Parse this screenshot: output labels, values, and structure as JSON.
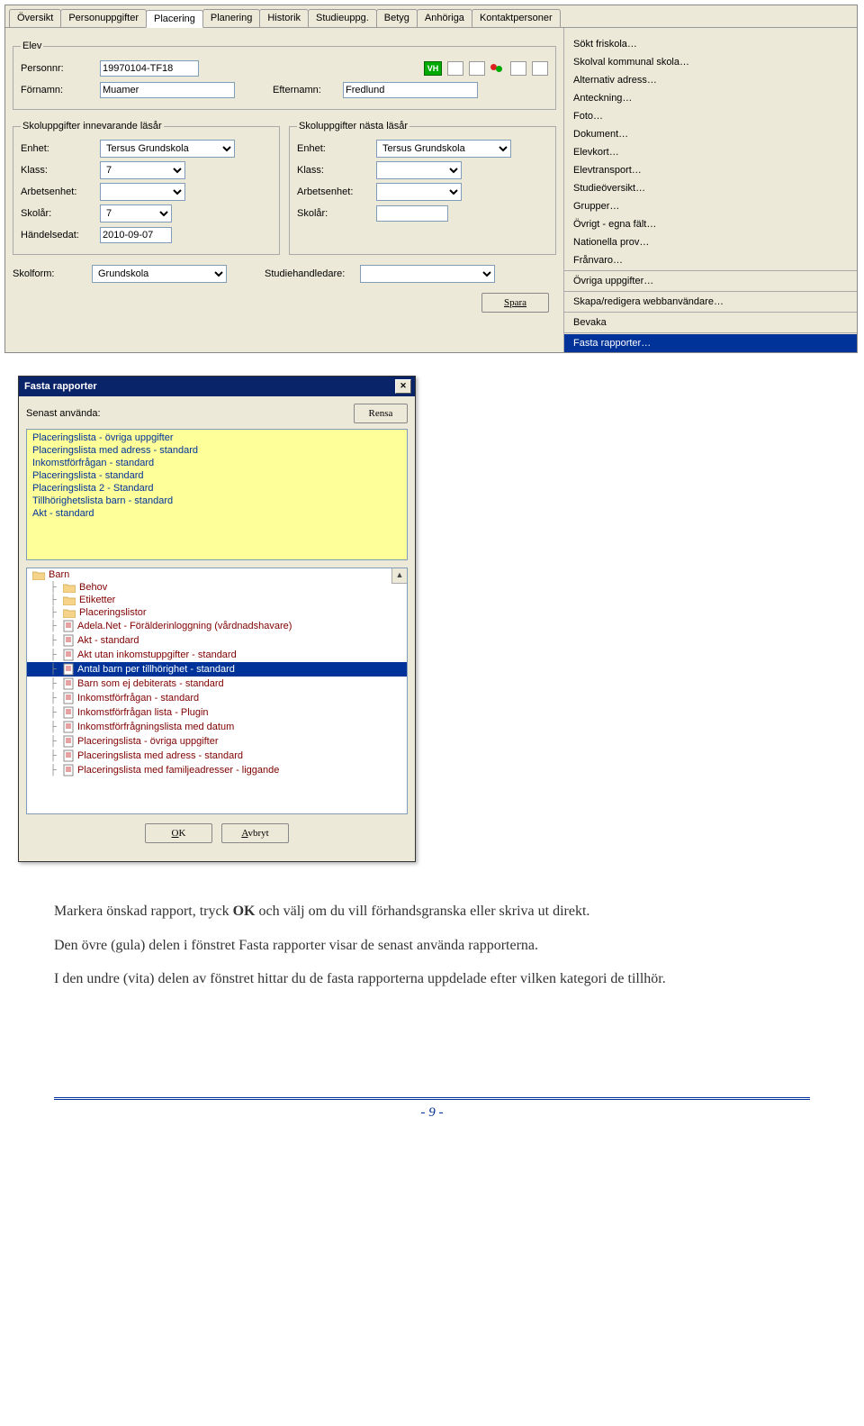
{
  "tabs": [
    "Översikt",
    "Personuppgifter",
    "Placering",
    "Planering",
    "Historik",
    "Studieuppg.",
    "Betyg",
    "Anhöriga",
    "Kontaktpersoner"
  ],
  "active_tab": 2,
  "elev": {
    "legend": "Elev",
    "personnr_label": "Personnr:",
    "personnr": "19970104-TF18",
    "fornamn_label": "Förnamn:",
    "fornamn": "Muamer",
    "efternamn_label": "Efternamn:",
    "efternamn": "Fredlund",
    "badge": "VH"
  },
  "box_current": {
    "legend": "Skoluppgifter innevarande läsår",
    "enhet_label": "Enhet:",
    "enhet": "Tersus Grundskola",
    "klass_label": "Klass:",
    "klass": "7",
    "ae_label": "Arbetsenhet:",
    "ae": "",
    "skolar_label": "Skolår:",
    "skolar": "7",
    "hdat_label": "Händelsedat:",
    "hdat": "2010-09-07"
  },
  "box_next": {
    "legend": "Skoluppgifter nästa läsår",
    "enhet_label": "Enhet:",
    "enhet": "Tersus Grundskola",
    "klass_label": "Klass:",
    "klass": "",
    "ae_label": "Arbetsenhet:",
    "ae": "",
    "skolar_label": "Skolår:",
    "skolar": ""
  },
  "bottom": {
    "skolform_label": "Skolform:",
    "skolform": "Grundskola",
    "studiehandl_label": "Studiehandledare:",
    "studiehandl": ""
  },
  "save_btn": "Spara",
  "menu": [
    "Sökt friskola…",
    "Skolval kommunal skola…",
    "Alternativ adress…",
    "Anteckning…",
    "Foto…",
    "Dokument…",
    "Elevkort…",
    "Elevtransport…",
    "Studieöversikt…",
    "Grupper…",
    "Övrigt - egna fält…",
    "Nationella prov…",
    "Frånvaro…",
    "---",
    "Övriga uppgifter…",
    "---",
    "Skapa/redigera webbanvändare…",
    "---",
    "Bevaka",
    "---",
    "Fasta rapporter…"
  ],
  "menu_selected": "Fasta rapporter…",
  "dialog": {
    "title": "Fasta rapporter",
    "senast_label": "Senast använda:",
    "rensa_btn": "Rensa",
    "recent": [
      "Placeringslista - övriga uppgifter",
      "Placeringslista med adress - standard",
      "Inkomstförfrågan - standard",
      "Placeringslista - standard",
      "Placeringslista 2 - Standard",
      "Tillhörighetslista barn - standard",
      "Akt - standard"
    ],
    "tree": [
      {
        "t": "folder",
        "lvl": 0,
        "label": "Barn"
      },
      {
        "t": "folder",
        "lvl": 1,
        "label": "Behov"
      },
      {
        "t": "folder",
        "lvl": 1,
        "label": "Etiketter"
      },
      {
        "t": "folder",
        "lvl": 1,
        "label": "Placeringslistor"
      },
      {
        "t": "doc",
        "lvl": 1,
        "label": "Adela.Net - Förälderinloggning (vårdnadshavare)"
      },
      {
        "t": "doc",
        "lvl": 1,
        "label": "Akt - standard"
      },
      {
        "t": "doc",
        "lvl": 1,
        "label": "Akt utan inkomstuppgifter - standard"
      },
      {
        "t": "doc",
        "lvl": 1,
        "label": "Antal barn per tillhörighet - standard",
        "sel": true
      },
      {
        "t": "doc",
        "lvl": 1,
        "label": "Barn som ej debiterats - standard"
      },
      {
        "t": "doc",
        "lvl": 1,
        "label": "Inkomstförfrågan - standard"
      },
      {
        "t": "doc",
        "lvl": 1,
        "label": "Inkomstförfrågan lista - Plugin"
      },
      {
        "t": "doc",
        "lvl": 1,
        "label": "Inkomstförfrågningslista med datum"
      },
      {
        "t": "doc",
        "lvl": 1,
        "label": "Placeringslista - övriga uppgifter"
      },
      {
        "t": "doc",
        "lvl": 1,
        "label": "Placeringslista med adress - standard"
      },
      {
        "t": "doc",
        "lvl": 1,
        "label": "Placeringslista med familjeadresser - liggande"
      }
    ],
    "ok_btn": "OK",
    "avbryt_btn": "Avbryt"
  },
  "body_text": {
    "p1a": "Markera önskad rapport, tryck ",
    "p1b": "OK",
    "p1c": " och välj om du vill förhandsgranska eller skriva ut direkt.",
    "p2": "Den övre (gula) delen i fönstret  Fasta rapporter visar de senast använda rapporterna.",
    "p3": "I den undre (vita) delen av fönstret hittar du de fasta rapporterna uppdelade efter vilken kategori de tillhör."
  },
  "page_number": "- 9 -"
}
